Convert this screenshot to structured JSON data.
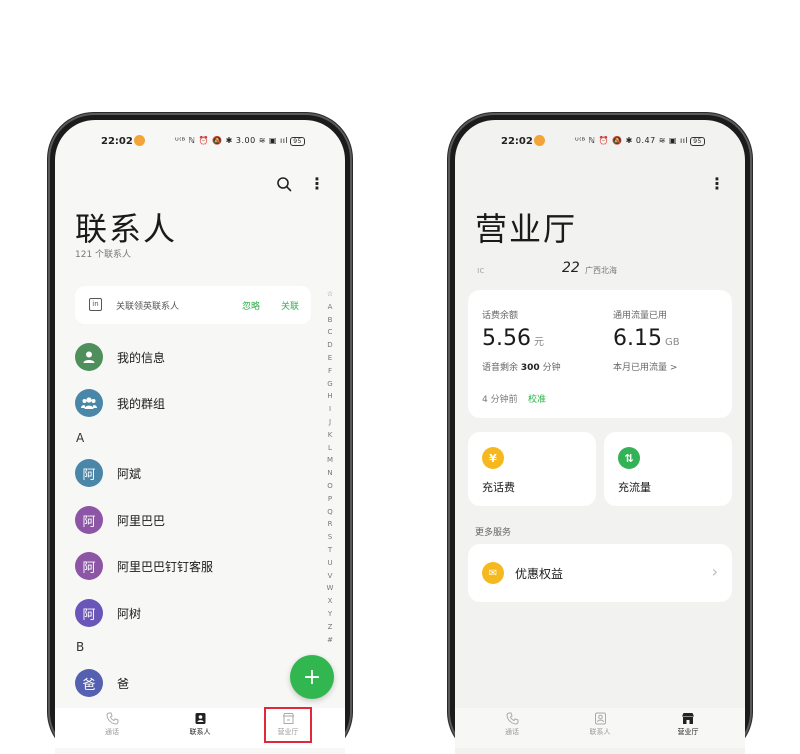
{
  "status_bar": {
    "time": "22:02",
    "left_icons": "ᵁ⁽ᴮ ℕ ⏰ 🔕 ✱ 3.00 ≋ ▣ ııl",
    "right_icons": "ᵁ⁽ᴮ ℕ ⏰ 🔕 ✱ 0.47 ≋ ▣ ııl",
    "battery": "95"
  },
  "contacts_screen": {
    "title": "联系人",
    "count": "121 个联系人",
    "linkedin": {
      "icon_text": "in",
      "text": "关联领英联系人",
      "ignore_label": "忽略",
      "link_label": "关联"
    },
    "contacts": [
      {
        "name": "我的信息",
        "avatar": "👤",
        "color": "#4f8f5b"
      },
      {
        "name": "我的群组",
        "avatar": "👥",
        "color": "#4a86a8"
      }
    ],
    "section_a": "A",
    "contacts_a": [
      {
        "name": "阿斌",
        "avatar": "阿",
        "color": "#4a86a8"
      },
      {
        "name": "阿里巴巴",
        "avatar": "阿",
        "color": "#8d55a6"
      },
      {
        "name": "阿里巴巴钉钉客服",
        "avatar": "阿",
        "color": "#8d55a6"
      },
      {
        "name": "阿树",
        "avatar": "阿",
        "color": "#6a56b8"
      }
    ],
    "section_b": "B",
    "contacts_b": [
      {
        "name": "爸",
        "avatar": "爸",
        "color": "#5560b0"
      }
    ],
    "alpha_index": [
      "☆",
      "A",
      "B",
      "C",
      "D",
      "E",
      "F",
      "G",
      "H",
      "I",
      "J",
      "K",
      "L",
      "M",
      "N",
      "O",
      "P",
      "Q",
      "R",
      "S",
      "T",
      "U",
      "V",
      "W",
      "X",
      "Y",
      "Z",
      "#"
    ],
    "fab": "+"
  },
  "bottom_nav": {
    "calls": "通话",
    "contacts": "联系人",
    "service_hall": "营业厅"
  },
  "service_screen": {
    "title": "营业厅",
    "location_prefix": "ıc",
    "location_number": "22",
    "location_text": "广西北海",
    "balance_label": "话费余额",
    "balance_value": "5.56",
    "balance_unit": "元",
    "voice_prefix": "语音剩余",
    "voice_value": "300",
    "voice_unit": "分钟",
    "data_label": "通用流量已用",
    "data_value": "6.15",
    "data_unit": "GB",
    "data_link": "本月已用流量 >",
    "updated": "4 分钟前",
    "calibrate": "校准",
    "recharge_fee": "充话费",
    "recharge_fee_icon": "¥",
    "recharge_data": "充流量",
    "recharge_data_icon": "⇅",
    "more_services": "更多服务",
    "benefits": "优惠权益",
    "benefits_icon": "✉"
  },
  "colors": {
    "accent_green": "#2db34a",
    "fab_green": "#32b650",
    "fee_yellow": "#f6b81f",
    "data_green": "#34b356",
    "highlight_red": "#e0283a"
  }
}
